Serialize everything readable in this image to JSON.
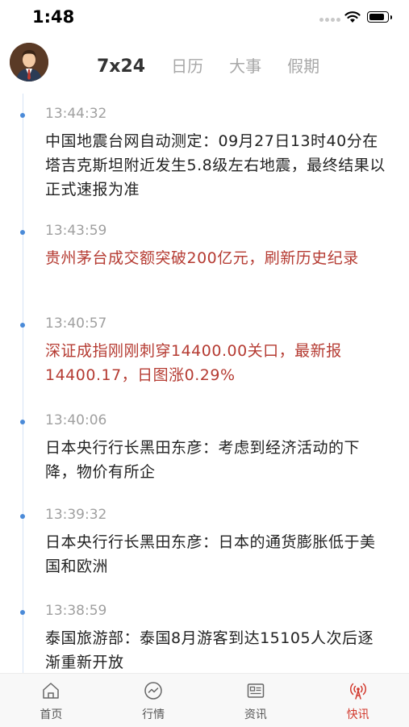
{
  "status_bar": {
    "time": "1:48"
  },
  "header": {
    "tabs": [
      {
        "label": "7x24",
        "active": true
      },
      {
        "label": "日历",
        "active": false
      },
      {
        "label": "大事",
        "active": false
      },
      {
        "label": "假期",
        "active": false
      }
    ]
  },
  "feed": {
    "items": [
      {
        "time": "13:44:32",
        "text": "中国地震台网自动测定：09月27日13时40分在塔吉克斯坦附近发生5.8级左右地震，最终结果以正式速报为准",
        "highlight": false
      },
      {
        "time": "13:43:59",
        "text": "贵州茅台成交额突破200亿元，刷新历史纪录",
        "highlight": true
      },
      {
        "time": "13:40:57",
        "text": "深证成指刚刚刺穿14400.00关口，最新报14400.17，日图涨0.29%",
        "highlight": true
      },
      {
        "time": "13:40:06",
        "text": "日本央行行长黑田东彦：考虑到经济活动的下降，物价有所企",
        "highlight": false
      },
      {
        "time": "13:39:32",
        "text": "日本央行行长黑田东彦：日本的通货膨胀低于美国和欧洲",
        "highlight": false
      },
      {
        "time": "13:38:59",
        "text": "泰国旅游部：泰国8月游客到达15105人次后逐渐重新开放",
        "highlight": false
      }
    ]
  },
  "bottom_nav": {
    "items": [
      {
        "label": "首页",
        "icon": "home-icon",
        "active": false
      },
      {
        "label": "行情",
        "icon": "market-trend-icon",
        "active": false
      },
      {
        "label": "资讯",
        "icon": "news-icon",
        "active": false
      },
      {
        "label": "快讯",
        "icon": "broadcast-icon",
        "active": true
      }
    ]
  },
  "colors": {
    "accent_red": "#d2382c",
    "highlight_text": "#b53b32",
    "timeline_dot": "#4a8ad8",
    "inactive_tab": "#a8a8a8"
  }
}
